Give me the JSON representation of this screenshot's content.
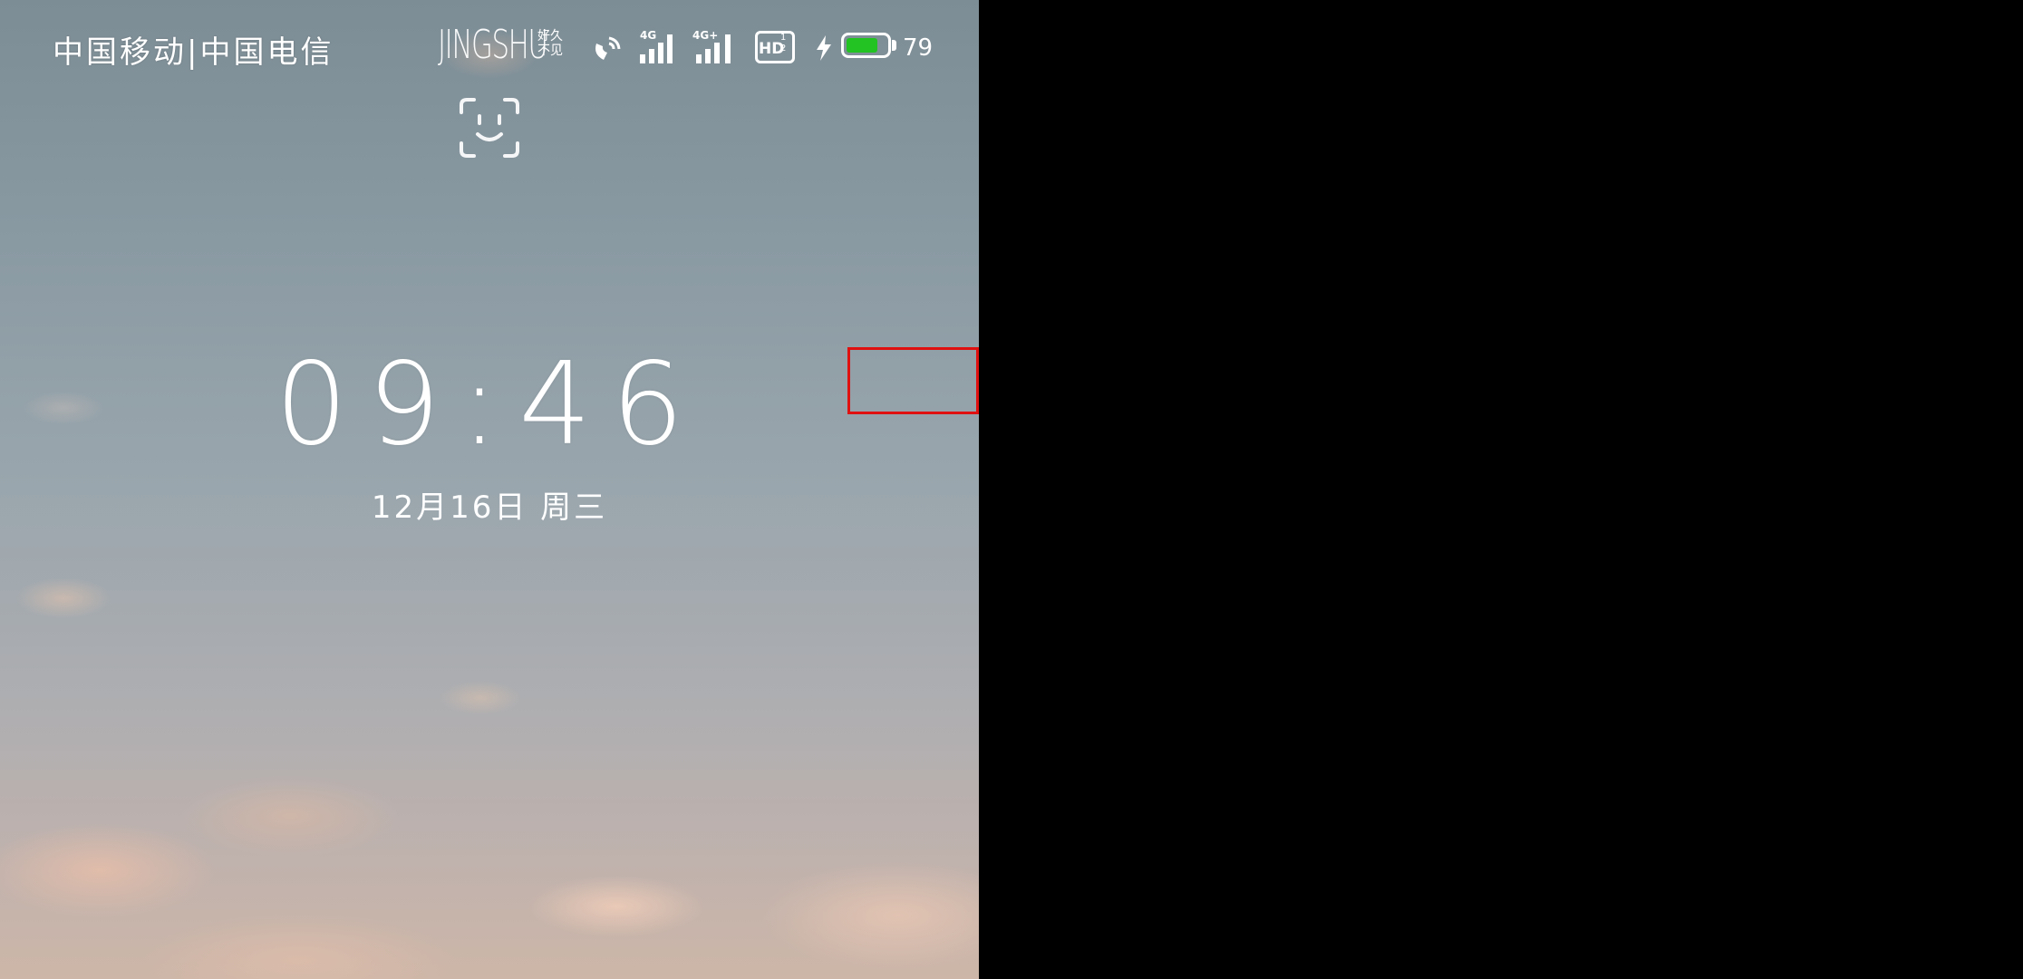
{
  "status_bar": {
    "carrier": "中国移动|中国电信",
    "brand": "JINGSHU",
    "brand_sub": "好久不见",
    "signal1_label": "4G",
    "signal2_label": "4G+",
    "hd_label": "HD",
    "hd_sub": "1 2",
    "battery_percent": "79",
    "battery_level": 0.79,
    "battery_color": "#22c322"
  },
  "icons": [
    "face-unlock-icon",
    "wifi-calling-icon",
    "signal-icon",
    "hd-voice-icon",
    "charging-icon",
    "battery-icon"
  ],
  "lockscreen": {
    "time": "09:46",
    "date": "12月16日 周三"
  },
  "highlight": {
    "color": "#e01010"
  }
}
